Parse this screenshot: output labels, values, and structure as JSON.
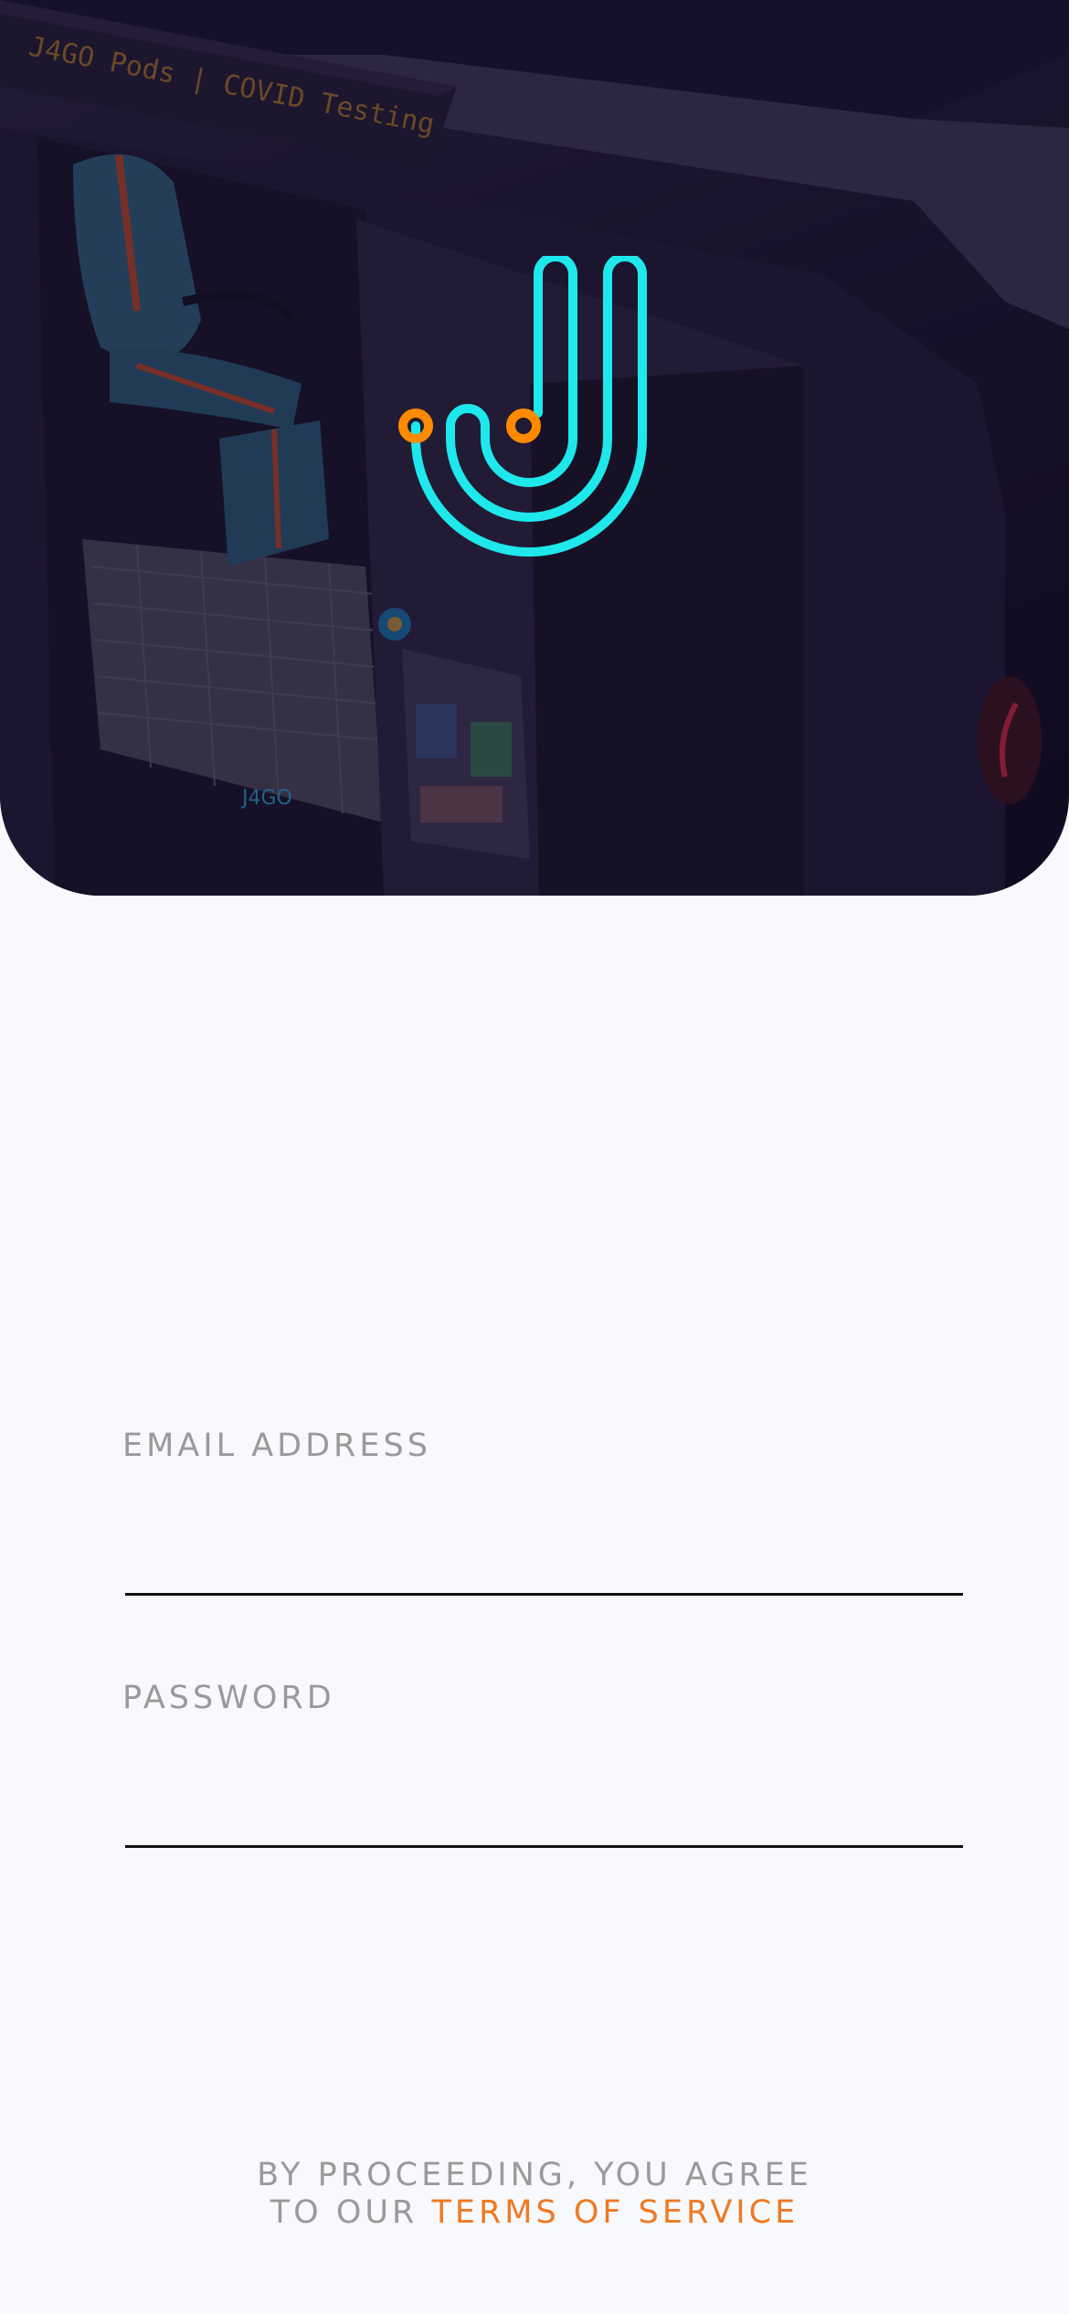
{
  "hero": {
    "pod_sign_text": "J4GO Pods | COVID Testing",
    "pod_brand_text": "J4GO"
  },
  "logo": {
    "icon": "jago-j-logo-icon",
    "primary_color": "#1ee8ec",
    "accent_color": "#ff8a00"
  },
  "form": {
    "email_label": "EMAIL ADDRESS",
    "email_value": "",
    "email_placeholder": "",
    "password_label": "PASSWORD",
    "password_value": "",
    "password_placeholder": ""
  },
  "footer": {
    "agree_line1": "BY PROCEEDING, YOU AGREE",
    "agree_prefix": "TO OUR ",
    "terms_link": "TERMS OF SERVICE"
  },
  "colors": {
    "background": "#f7f9fc",
    "label_gray": "#9a9a9a",
    "link_orange": "#ee7a24",
    "hero_dark": "#1c1530"
  }
}
